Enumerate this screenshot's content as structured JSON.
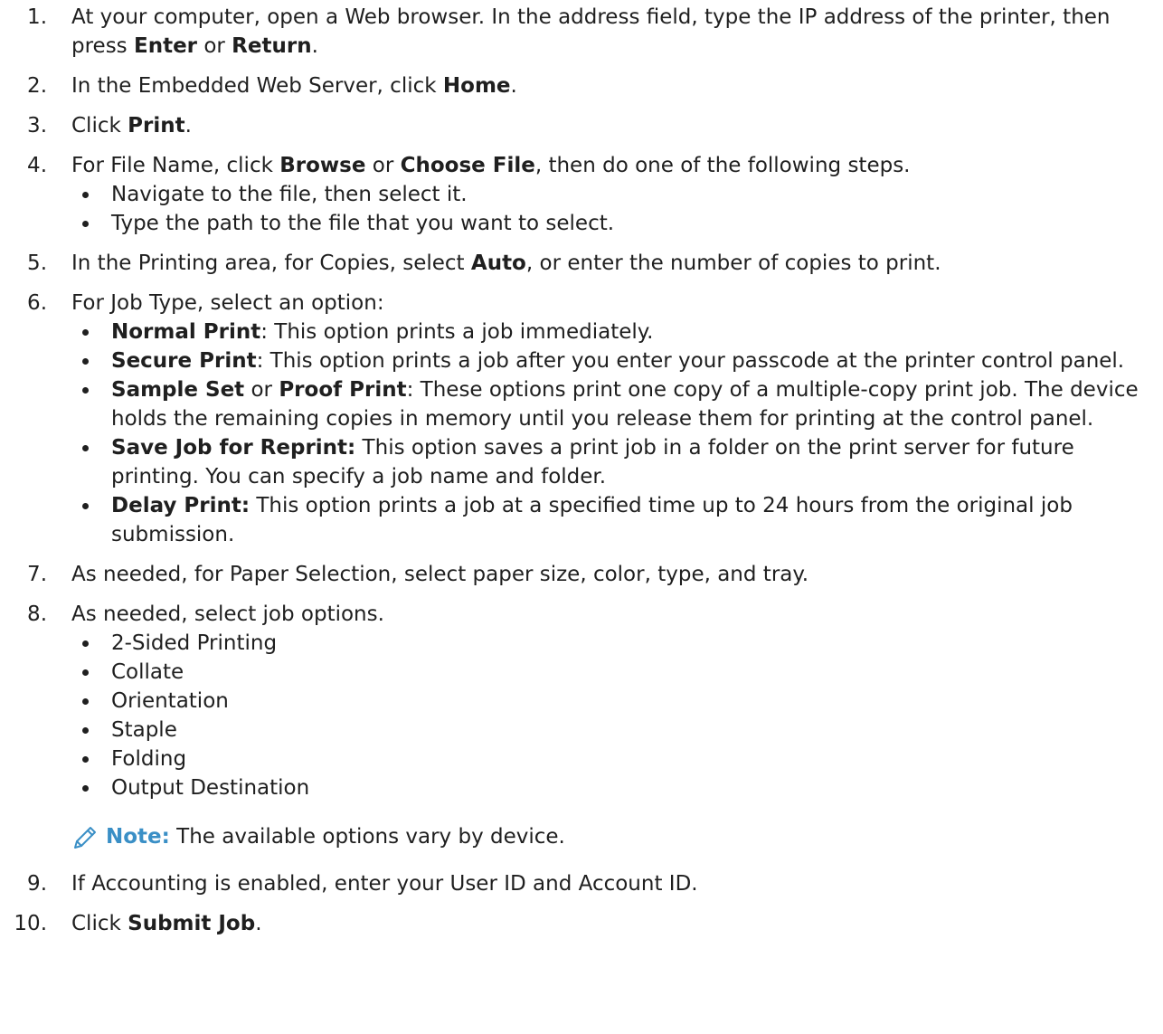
{
  "steps": [
    {
      "num": "1",
      "parts": [
        "At your computer, open a Web browser. In the address field, type the IP address of the printer, then press ",
        "Enter",
        " or ",
        "Return",
        "."
      ]
    },
    {
      "num": "2",
      "parts": [
        "In the Embedded Web Server, click ",
        "Home",
        "."
      ]
    },
    {
      "num": "3",
      "parts": [
        "Click ",
        "Print",
        "."
      ]
    },
    {
      "num": "4",
      "parts": [
        "For File Name, click ",
        "Browse",
        " or ",
        "Choose File",
        ", then do one of the following steps."
      ],
      "bullets": [
        "Navigate to the file, then select it.",
        "Type the path to the file that you want to select."
      ]
    },
    {
      "num": "5",
      "parts": [
        "In the Printing area, for Copies, select ",
        "Auto",
        ", or enter the number of copies to print."
      ]
    },
    {
      "num": "6",
      "text": "For Job Type, select an option:",
      "options": [
        {
          "parts": [
            "Normal Print",
            ": This option prints a job immediately."
          ]
        },
        {
          "parts": [
            "Secure Print",
            ": This option prints a job after you enter your passcode at the printer control panel."
          ]
        },
        {
          "parts": [
            "Sample Set",
            " or ",
            "Proof Print",
            ": These options print one copy of a multiple-copy print job. The device holds the remaining copies in memory until you release them for printing at the control panel."
          ]
        },
        {
          "parts": [
            "Save Job for Reprint:",
            " This option saves a print job in a folder on the print server for future printing. You can specify a job name and folder."
          ]
        },
        {
          "parts": [
            "Delay Print:",
            " This option prints a job at a specified time up to 24 hours from the original job submission."
          ]
        }
      ]
    },
    {
      "num": "7",
      "text": "As needed, for Paper Selection, select paper size, color, type, and tray."
    },
    {
      "num": "8",
      "text": "As needed, select job options.",
      "bullets": [
        "2-Sided Printing",
        "Collate",
        "Orientation",
        "Staple",
        "Folding",
        "Output Destination"
      ],
      "note": {
        "icon": "pencil-icon",
        "label": "Note:",
        "text": " The available options vary by device."
      }
    },
    {
      "num": "9",
      "text": "If Accounting is enabled, enter your User ID and Account ID."
    },
    {
      "num": "10",
      "parts": [
        "Click ",
        "Submit Job",
        "."
      ]
    }
  ],
  "colors": {
    "note_accent": "#3a8fc6",
    "text": "#1f1f1f"
  }
}
